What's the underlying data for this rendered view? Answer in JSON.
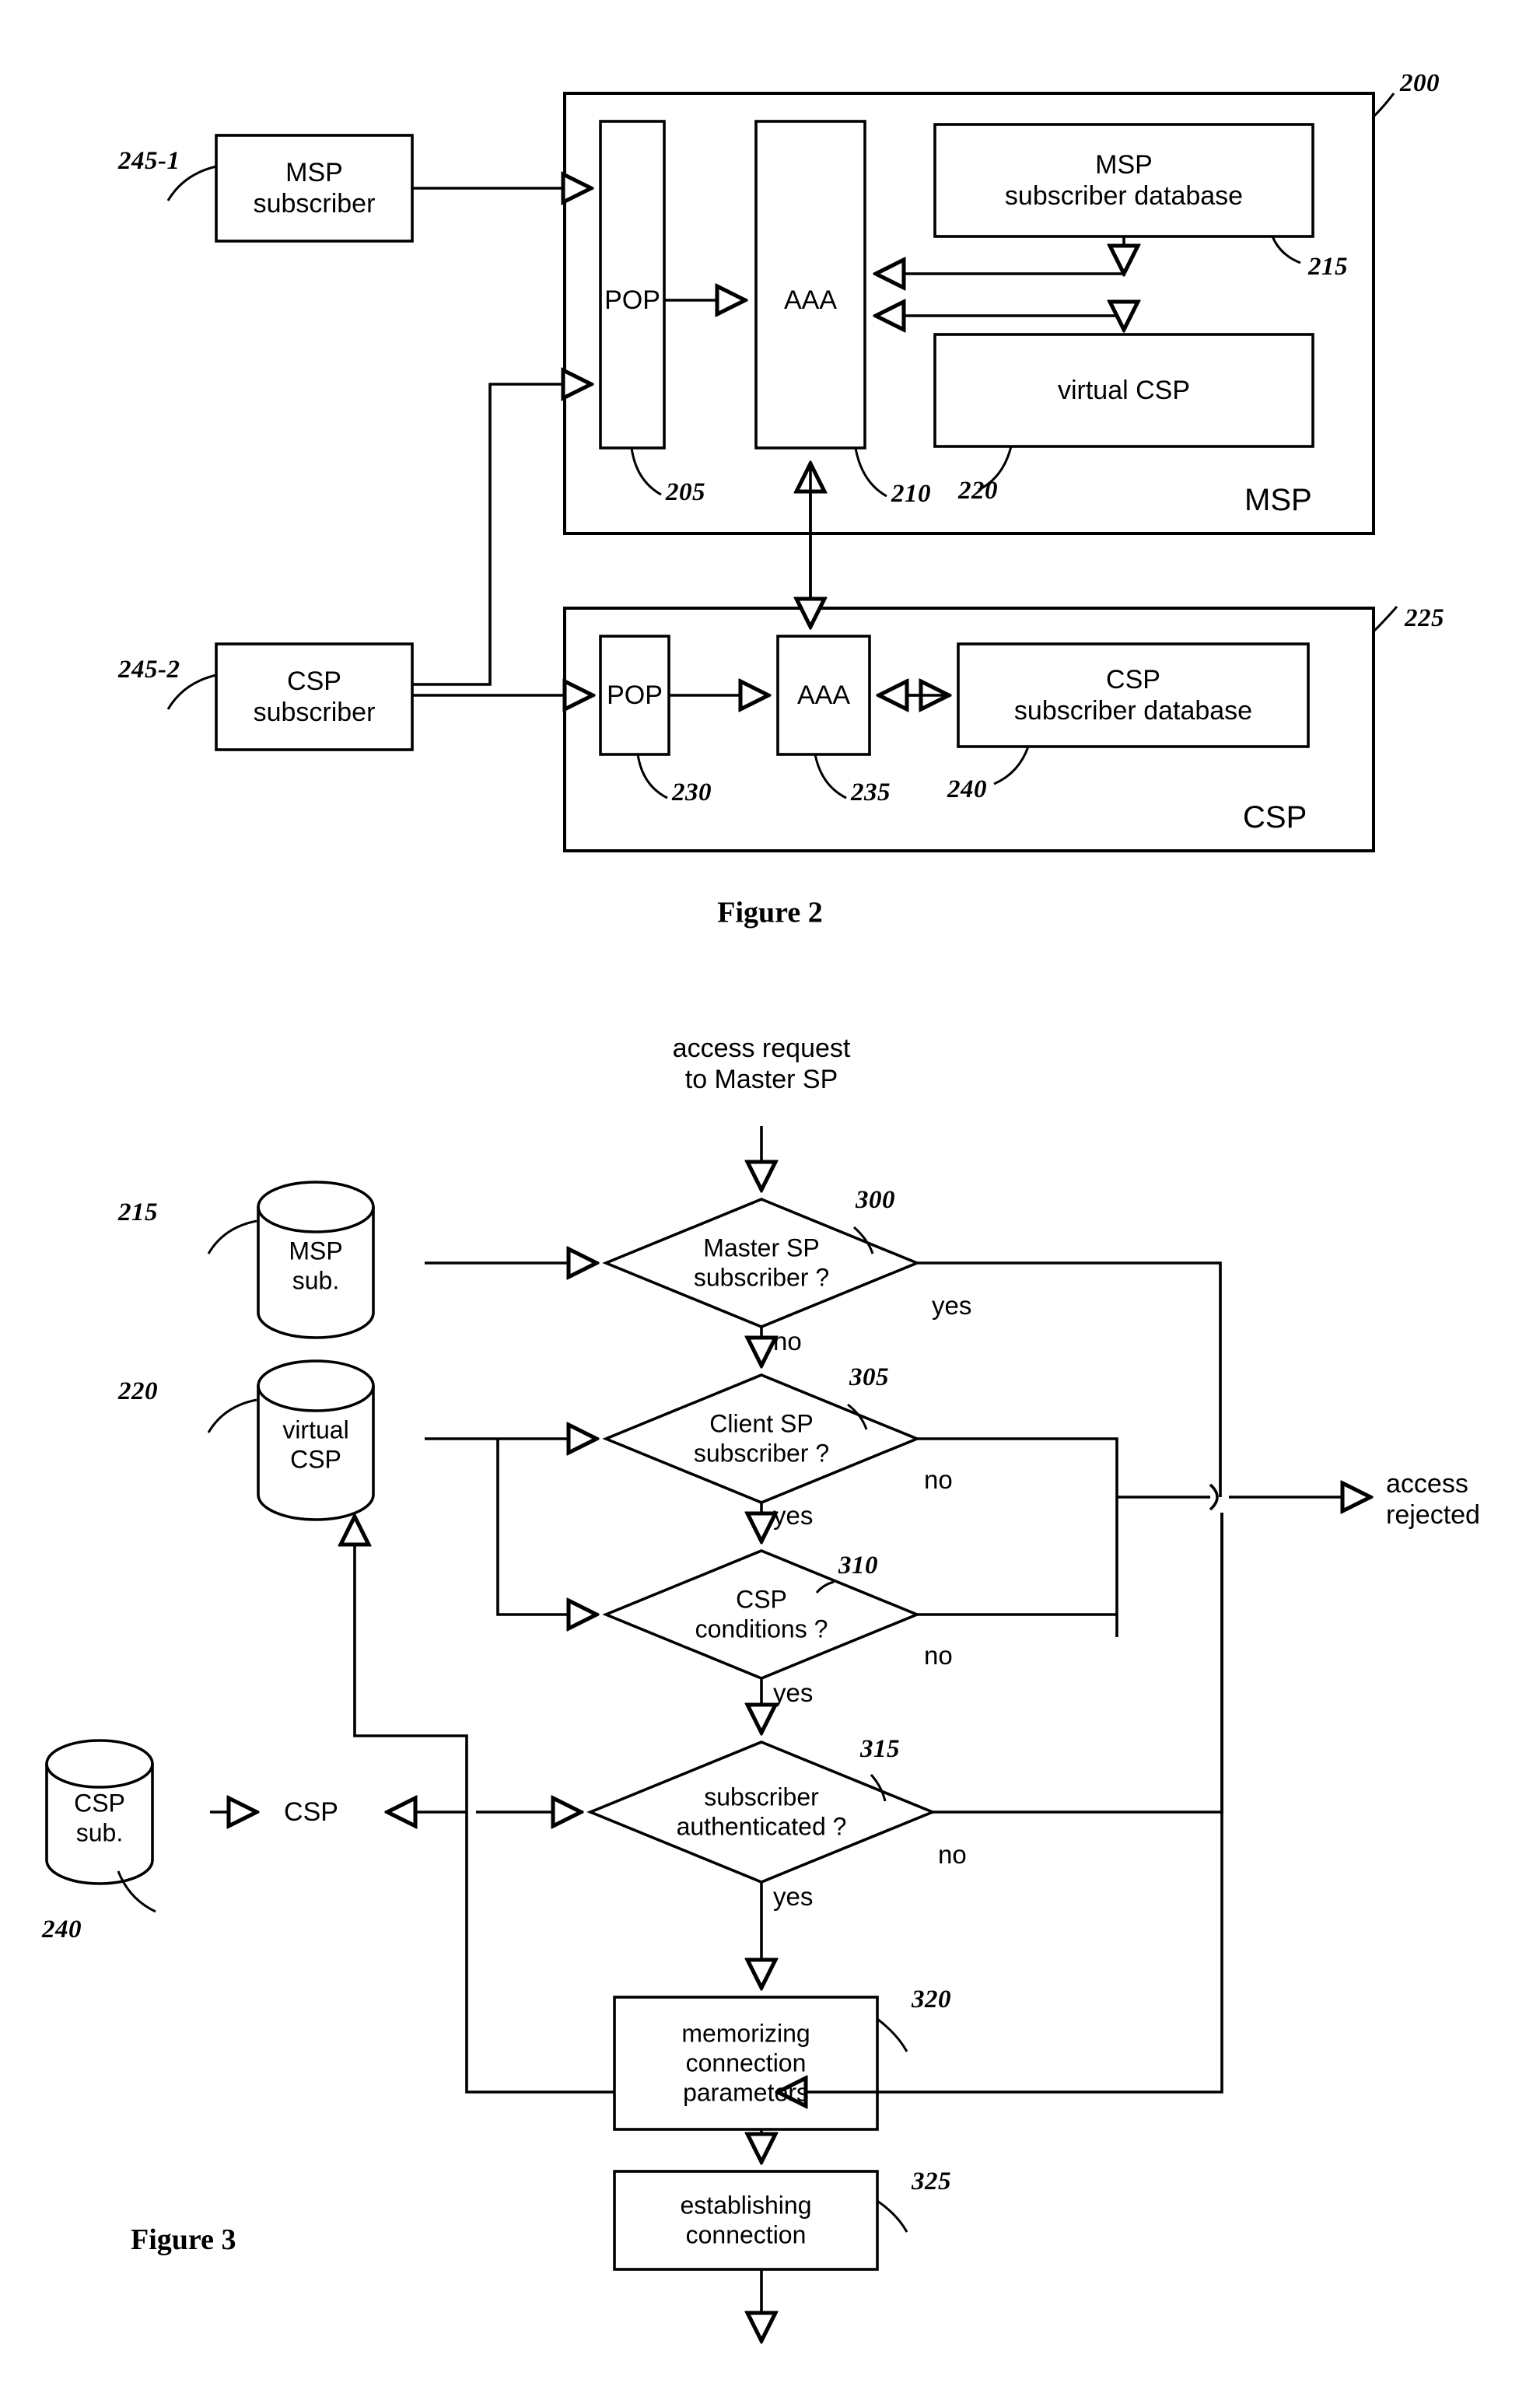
{
  "figure2": {
    "caption": "Figure 2",
    "outer_refs": {
      "msp_system": "200",
      "csp_system": "225"
    },
    "msp_block": {
      "title": "MSP",
      "pop": {
        "label": "POP",
        "ref": "205"
      },
      "aaa": {
        "label": "AAA",
        "ref": "210"
      },
      "subscriber_db": {
        "line1": "MSP",
        "line2": "subscriber database",
        "ref": "215"
      },
      "virtual_csp": {
        "label": "virtual CSP",
        "ref": "220"
      }
    },
    "csp_block": {
      "title": "CSP",
      "pop": {
        "label": "POP",
        "ref": "230"
      },
      "aaa": {
        "label": "AAA",
        "ref": "235"
      },
      "subscriber_db": {
        "line1": "CSP",
        "line2": "subscriber database",
        "ref": "240"
      }
    },
    "subscribers": [
      {
        "line1": "MSP",
        "line2": "subscriber",
        "ref": "245-1"
      },
      {
        "line1": "CSP",
        "line2": "subscriber",
        "ref": "245-2"
      }
    ]
  },
  "figure3": {
    "caption": "Figure 3",
    "entry": {
      "line1": "access request",
      "line2": "to Master SP"
    },
    "exit_reject": {
      "line1": "access",
      "line2": "rejected"
    },
    "csp_out_label": "CSP",
    "stores": [
      {
        "line1": "MSP",
        "line2": "sub.",
        "ref": "215"
      },
      {
        "line1": "virtual",
        "line2": "CSP",
        "ref": "220"
      },
      {
        "line1": "CSP",
        "line2": "sub.",
        "ref": "240"
      }
    ],
    "decisions": [
      {
        "line1": "Master SP",
        "line2": "subscriber ?",
        "ref": "300",
        "yes": "yes",
        "no": "no",
        "yes_side": "right",
        "no_side": "bottom"
      },
      {
        "line1": "Client SP",
        "line2": "subscriber ?",
        "ref": "305",
        "yes": "yes",
        "no": "no",
        "yes_side": "bottom",
        "no_side": "right"
      },
      {
        "line1": "CSP",
        "line2": "conditions ?",
        "ref": "310",
        "yes": "yes",
        "no": "no",
        "yes_side": "bottom",
        "no_side": "right"
      },
      {
        "line1": "subscriber",
        "line2": "authenticated ?",
        "ref": "315",
        "yes": "yes",
        "no": "no",
        "yes_side": "bottom",
        "no_side": "right"
      }
    ],
    "processes": [
      {
        "line1": "memorizing",
        "line2": "connection",
        "line3": "parameters",
        "ref": "320"
      },
      {
        "line1": "establishing",
        "line2": "connection",
        "ref": "325"
      }
    ]
  },
  "style": {
    "ink": "#000000",
    "paper": "#ffffff"
  }
}
